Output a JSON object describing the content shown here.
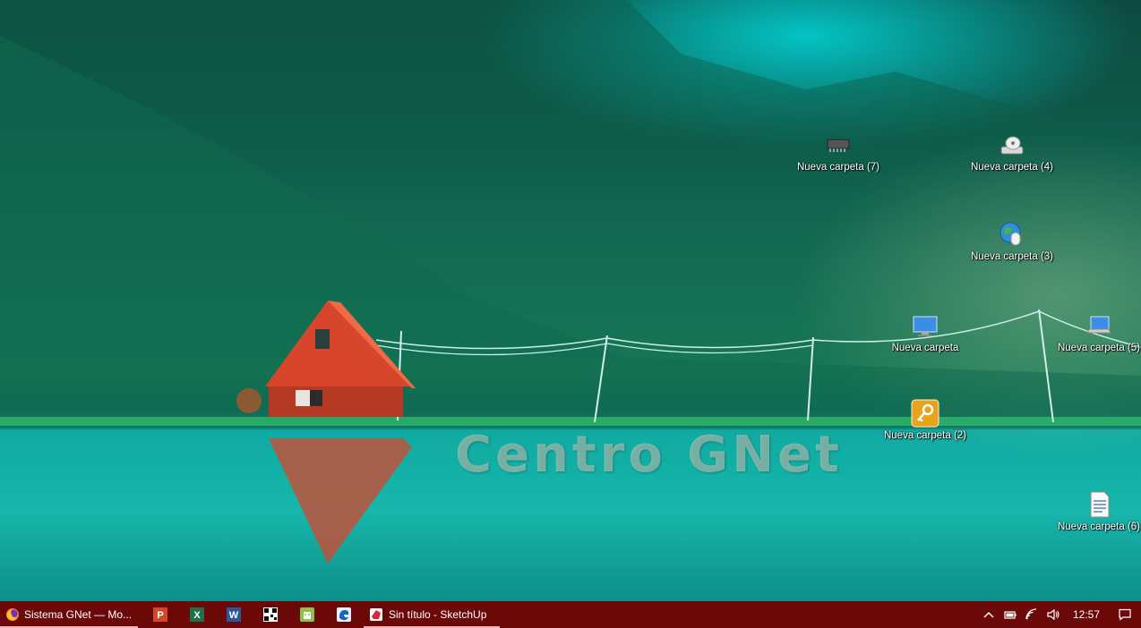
{
  "watermark": "Centro GNet",
  "desktop_icons": [
    {
      "label": "Nueva carpeta (7)",
      "icon": "chip-icon"
    },
    {
      "label": "Nueva carpeta (4)",
      "icon": "cd-drive-icon"
    },
    {
      "label": "Nueva carpeta (3)",
      "icon": "globe-mouse-icon"
    },
    {
      "label": "Nueva carpeta",
      "icon": "monitor-icon"
    },
    {
      "label": "Nueva carpeta (5)",
      "icon": "laptop-icon"
    },
    {
      "label": "Nueva carpeta (2)",
      "icon": "key-icon"
    },
    {
      "label": "Nueva carpeta (6)",
      "icon": "document-icon"
    }
  ],
  "taskbar": {
    "window_buttons": [
      {
        "label": "Sistema GNet — Mo...",
        "icon": "firefox-icon"
      },
      {
        "label": "Sin título - SketchUp",
        "icon": "sketchup-icon"
      }
    ],
    "pinned_apps": [
      "powerpoint-icon",
      "excel-icon",
      "word-icon",
      "qr-app-icon",
      "android-app-icon",
      "blue-app-icon"
    ],
    "clock": "12:57"
  },
  "colors": {
    "taskbar": "#6b0808",
    "active_underline": "#f4b2b2"
  }
}
